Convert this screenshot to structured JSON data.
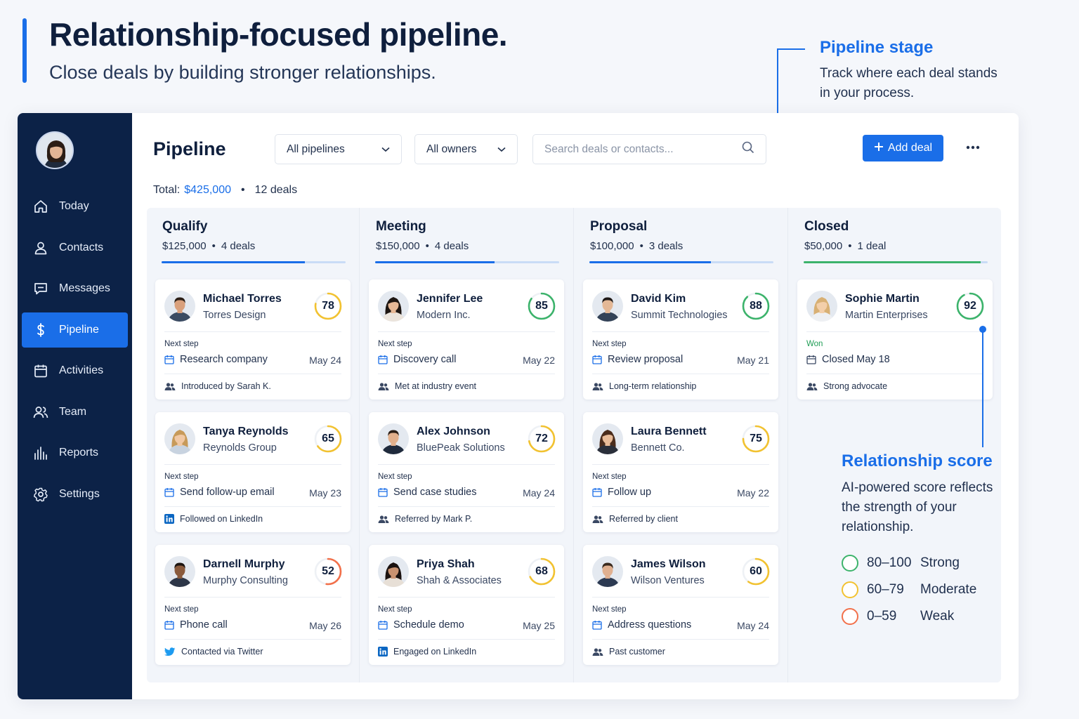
{
  "hero": {
    "title": "Relationship-focused pipeline.",
    "subtitle": "Close deals by building stronger relationships."
  },
  "callouts": {
    "stage": {
      "title": "Pipeline stage",
      "text": "Track where each deal stands in your process."
    },
    "score": {
      "title": "Relationship score",
      "text": "AI-powered score reflects the strength of your relationship."
    }
  },
  "legend": [
    {
      "range": "80–100",
      "label": "Strong",
      "color": "#3cb36b"
    },
    {
      "range": "60–79",
      "label": "Moderate",
      "color": "#f2c230"
    },
    {
      "range": "0–59",
      "label": "Weak",
      "color": "#f2704a"
    }
  ],
  "sidebar": {
    "items": [
      {
        "label": "Today",
        "icon": "home-icon"
      },
      {
        "label": "Contacts",
        "icon": "user-icon"
      },
      {
        "label": "Messages",
        "icon": "chat-icon"
      },
      {
        "label": "Pipeline",
        "icon": "dollar-icon",
        "active": true
      },
      {
        "label": "Activities",
        "icon": "calendar-icon"
      },
      {
        "label": "Team",
        "icon": "team-icon"
      },
      {
        "label": "Reports",
        "icon": "chart-icon"
      },
      {
        "label": "Settings",
        "icon": "gear-icon"
      }
    ]
  },
  "header": {
    "title": "Pipeline",
    "pipelines_select": "All pipelines",
    "owners_select": "All owners",
    "search_placeholder": "Search deals or contacts...",
    "add_label": "Add deal",
    "total_label": "Total:",
    "total_amount": "$425,000",
    "deal_count": "12 deals"
  },
  "colors": {
    "accent": "#1a6ee8",
    "sidebar": "#0c2247",
    "won": "#1f9d55"
  },
  "columns": [
    {
      "title": "Qualify",
      "amount": "$125,000",
      "count": "4 deals",
      "progress": 0.78,
      "color": "#1a6ee8",
      "cards": [
        {
          "name": "Michael Torres",
          "company": "Torres Design",
          "score": 78,
          "label": "Next step",
          "step": "Research company",
          "date": "May 24",
          "source": "Introduced by Sarah K.",
          "source_icon": "people-icon"
        },
        {
          "name": "Tanya Reynolds",
          "company": "Reynolds Group",
          "score": 65,
          "label": "Next step",
          "step": "Send follow-up email",
          "date": "May 23",
          "source": "Followed on LinkedIn",
          "source_icon": "linkedin-icon"
        },
        {
          "name": "Darnell Murphy",
          "company": "Murphy Consulting",
          "score": 52,
          "label": "Next step",
          "step": "Phone call",
          "date": "May 26",
          "source": "Contacted via Twitter",
          "source_icon": "twitter-icon"
        }
      ]
    },
    {
      "title": "Meeting",
      "amount": "$150,000",
      "count": "4 deals",
      "progress": 0.65,
      "color": "#1a6ee8",
      "cards": [
        {
          "name": "Jennifer Lee",
          "company": "Modern Inc.",
          "score": 85,
          "label": "Next step",
          "step": "Discovery call",
          "date": "May 22",
          "source": "Met at industry event",
          "source_icon": "people-icon"
        },
        {
          "name": "Alex Johnson",
          "company": "BluePeak Solutions",
          "score": 72,
          "label": "Next step",
          "step": "Send case studies",
          "date": "May 24",
          "source": "Referred by Mark P.",
          "source_icon": "people-icon"
        },
        {
          "name": "Priya Shah",
          "company": "Shah & Associates",
          "score": 68,
          "label": "Next step",
          "step": "Schedule demo",
          "date": "May 25",
          "source": "Engaged on LinkedIn",
          "source_icon": "linkedin-icon"
        }
      ]
    },
    {
      "title": "Proposal",
      "amount": "$100,000",
      "count": "3 deals",
      "progress": 0.66,
      "color": "#1a6ee8",
      "cards": [
        {
          "name": "David Kim",
          "company": "Summit Technologies",
          "score": 88,
          "label": "Next step",
          "step": "Review proposal",
          "date": "May 21",
          "source": "Long-term relationship",
          "source_icon": "people-icon"
        },
        {
          "name": "Laura Bennett",
          "company": "Bennett Co.",
          "score": 75,
          "label": "Next step",
          "step": "Follow up",
          "date": "May 22",
          "source": "Referred by client",
          "source_icon": "people-icon"
        },
        {
          "name": "James Wilson",
          "company": "Wilson Ventures",
          "score": 60,
          "label": "Next step",
          "step": "Address questions",
          "date": "May 24",
          "source": "Past customer",
          "source_icon": "people-icon"
        }
      ]
    },
    {
      "title": "Closed",
      "amount": "$50,000",
      "count": "1 deal",
      "progress": 0.96,
      "color": "#3cb36b",
      "cards": [
        {
          "name": "Sophie Martin",
          "company": "Martin Enterprises",
          "score": 92,
          "label": "Won",
          "won": true,
          "step": "Closed May 18",
          "date": "",
          "source": "Strong advocate",
          "source_icon": "people-icon"
        }
      ]
    }
  ]
}
